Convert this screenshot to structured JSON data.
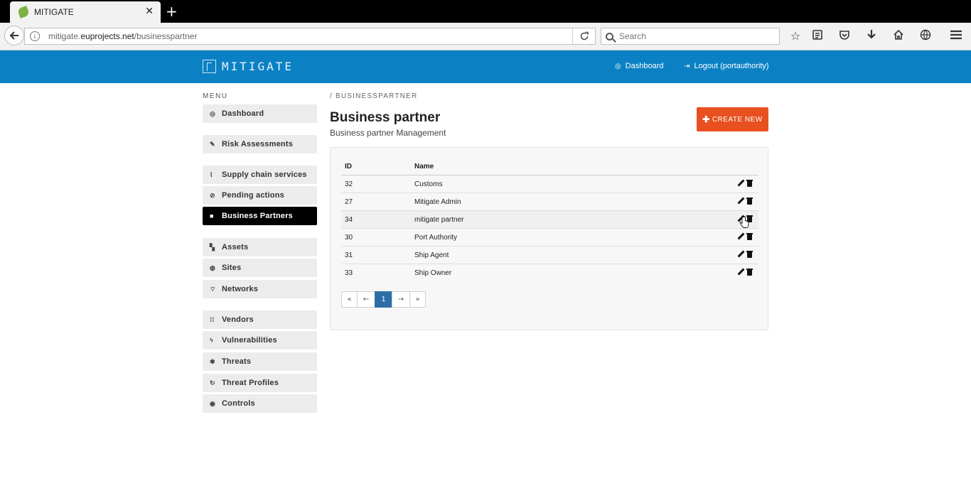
{
  "browser": {
    "tab_title": "MITIGATE",
    "tab_close": "✕",
    "new_tab": "+",
    "url_host_prefix": "mitigate.",
    "url_host_domain": "euprojects.net",
    "url_path": "/businesspartner",
    "search_placeholder": "Search",
    "toolbar_icons": [
      "bookmark-star-icon",
      "reading-list-icon",
      "pocket-icon",
      "download-icon",
      "home-icon",
      "globe-icon",
      "hamburger-menu-icon"
    ]
  },
  "header": {
    "brand": "MITIGATE",
    "dashboard_link": "Dashboard",
    "logout_link": "Logout (portauthority)"
  },
  "sidebar": {
    "menu_title": "MENU",
    "items": [
      {
        "label": "Dashboard",
        "icon": "dashboard-icon"
      },
      {
        "label": "Risk Assessments",
        "icon": "wrench-icon"
      },
      {
        "label": "Supply chain services",
        "icon": "supply-chain-icon"
      },
      {
        "label": "Pending actions",
        "icon": "pending-icon"
      },
      {
        "label": "Business Partners",
        "icon": "briefcase-icon",
        "active": true
      },
      {
        "label": "Assets",
        "icon": "assets-icon"
      },
      {
        "label": "Sites",
        "icon": "globe-icon"
      },
      {
        "label": "Networks",
        "icon": "wifi-icon"
      },
      {
        "label": "Vendors",
        "icon": "grid-icon"
      },
      {
        "label": "Vulnerabilities",
        "icon": "bolt-icon"
      },
      {
        "label": "Threats",
        "icon": "bug-icon"
      },
      {
        "label": "Threat Profiles",
        "icon": "refresh-icon"
      },
      {
        "label": "Controls",
        "icon": "eye-icon"
      }
    ]
  },
  "main": {
    "breadcrumb": "/ BUSINESSPARTNER",
    "title": "Business partner",
    "subtitle": "Business partner Management",
    "create_button": "CREATE NEW",
    "table": {
      "headers": {
        "id": "ID",
        "name": "Name"
      },
      "rows": [
        {
          "id": "32",
          "name": "Customs"
        },
        {
          "id": "27",
          "name": "Mitigate Admin"
        },
        {
          "id": "34",
          "name": "mitigate partner"
        },
        {
          "id": "30",
          "name": "Port Authority"
        },
        {
          "id": "31",
          "name": "Ship Agent"
        },
        {
          "id": "33",
          "name": "Ship Owner"
        }
      ]
    },
    "pagination": {
      "first": "«",
      "prev": "←",
      "current": "1",
      "next": "→",
      "last": "»"
    }
  },
  "colors": {
    "header_bg": "#0b81c4",
    "create_button": "#e8501f",
    "active_menu": "#000000",
    "current_page": "#2c6fa8"
  }
}
